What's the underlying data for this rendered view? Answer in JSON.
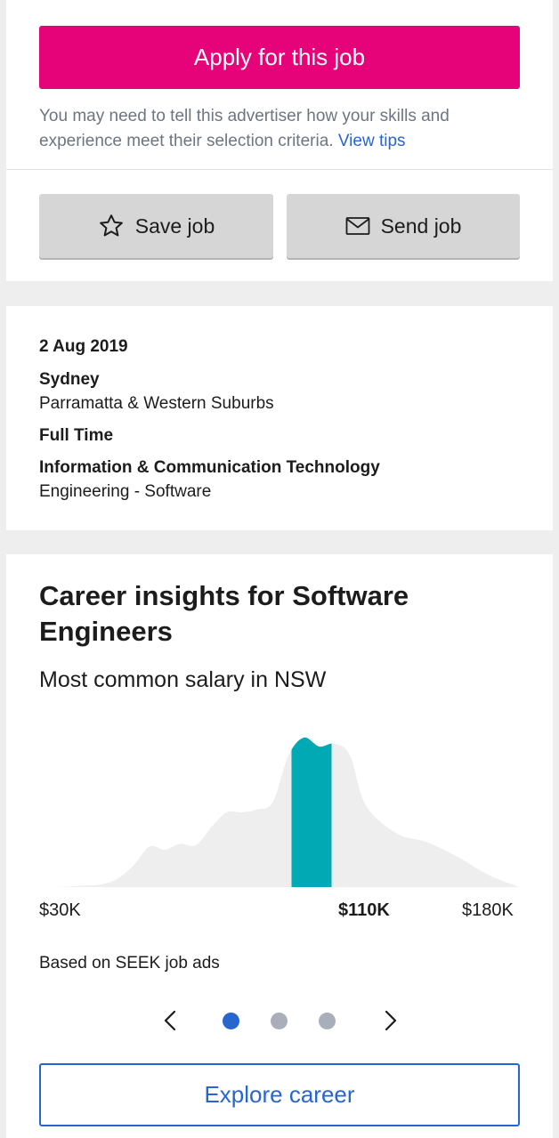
{
  "apply": {
    "button_label": "Apply for this job",
    "advisory_text": "You may need to tell this advertiser how your skills and experience meet their selection criteria.",
    "tips_link": "View tips",
    "save_label": "Save job",
    "save_icon": "star-icon",
    "send_label": "Send job",
    "send_icon": "envelope-icon"
  },
  "details": {
    "date": "2 Aug 2019",
    "location": "Sydney",
    "area": "Parramatta & Western Suburbs",
    "work_type": "Full Time",
    "classification": "Information & Communication Technology",
    "sub_classification": "Engineering - Software"
  },
  "insights": {
    "title": "Career insights for Software Engineers",
    "subtitle": "Most common salary in NSW",
    "footnote": "Based on SEEK job ads",
    "explore_label": "Explore career",
    "carousel": {
      "pages": 3,
      "active": 0,
      "prev_icon": "chevron-left-icon",
      "next_icon": "chevron-right-icon"
    }
  },
  "chart_data": {
    "type": "area",
    "x_min_label": "$30K",
    "x_highlight_label": "$110K",
    "x_max_label": "$180K",
    "x": [
      30,
      40,
      45,
      50,
      55,
      60,
      65,
      70,
      75,
      80,
      85,
      90,
      95,
      100,
      105,
      110,
      115,
      120,
      125,
      130,
      140,
      150,
      160,
      170,
      180
    ],
    "values": [
      0,
      1,
      2,
      6,
      15,
      27,
      25,
      29,
      28,
      40,
      50,
      50,
      52,
      57,
      88,
      100,
      94,
      96,
      88,
      55,
      36,
      30,
      20,
      8,
      0
    ],
    "highlight_range": [
      106,
      119
    ],
    "colors": {
      "distribution": "#eeeeee",
      "highlight": "#00a9b3"
    }
  },
  "colors": {
    "apply_button": "#e60278",
    "link": "#2765cf",
    "secondary_button": "#d6d6d6",
    "active_dot": "#2765cf",
    "inactive_dot": "#a9afba"
  }
}
